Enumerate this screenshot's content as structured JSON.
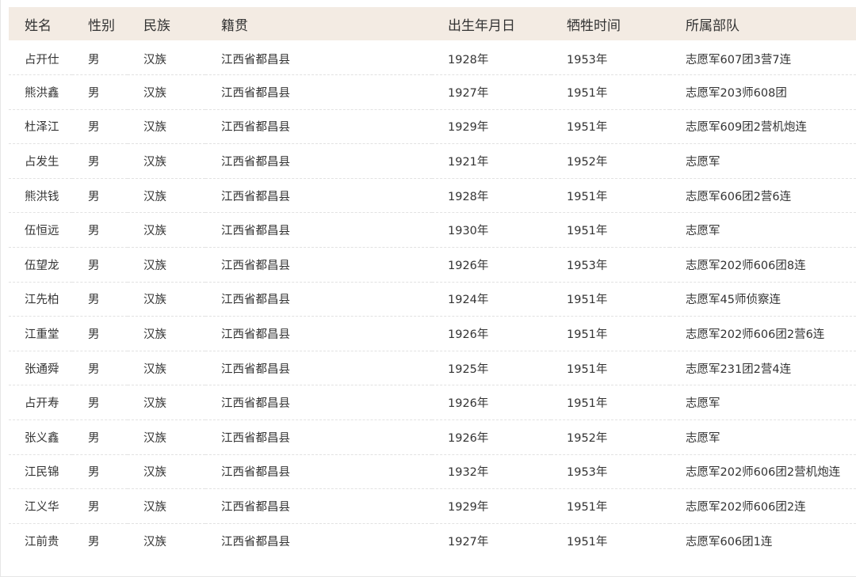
{
  "table": {
    "headers": [
      "姓名",
      "性别",
      "民族",
      "籍贯",
      "出生年月日",
      "牺牲时间",
      "所属部队"
    ],
    "rows": [
      [
        "占开仕",
        "男",
        "汉族",
        "江西省都昌县",
        "1928年",
        "1953年",
        "志愿军607团3营7连"
      ],
      [
        "熊洪鑫",
        "男",
        "汉族",
        "江西省都昌县",
        "1927年",
        "1951年",
        "志愿军203师608团"
      ],
      [
        "杜泽江",
        "男",
        "汉族",
        "江西省都昌县",
        "1929年",
        "1951年",
        "志愿军609团2营机炮连"
      ],
      [
        "占发生",
        "男",
        "汉族",
        "江西省都昌县",
        "1921年",
        "1952年",
        "志愿军"
      ],
      [
        "熊洪钱",
        "男",
        "汉族",
        "江西省都昌县",
        "1928年",
        "1951年",
        "志愿军606团2营6连"
      ],
      [
        "伍恒远",
        "男",
        "汉族",
        "江西省都昌县",
        "1930年",
        "1951年",
        "志愿军"
      ],
      [
        "伍望龙",
        "男",
        "汉族",
        "江西省都昌县",
        "1926年",
        "1953年",
        "志愿军202师606团8连"
      ],
      [
        "江先柏",
        "男",
        "汉族",
        "江西省都昌县",
        "1924年",
        "1951年",
        "志愿军45师侦察连"
      ],
      [
        "江重堂",
        "男",
        "汉族",
        "江西省都昌县",
        "1926年",
        "1951年",
        "志愿军202师606团2营6连"
      ],
      [
        "张通舜",
        "男",
        "汉族",
        "江西省都昌县",
        "1925年",
        "1951年",
        "志愿军231团2营4连"
      ],
      [
        "占开寿",
        "男",
        "汉族",
        "江西省都昌县",
        "1926年",
        "1951年",
        "志愿军"
      ],
      [
        "张义鑫",
        "男",
        "汉族",
        "江西省都昌县",
        "1926年",
        "1952年",
        "志愿军"
      ],
      [
        "江民锦",
        "男",
        "汉族",
        "江西省都昌县",
        "1932年",
        "1953年",
        "志愿军202师606团2营机炮连"
      ],
      [
        "江义华",
        "男",
        "汉族",
        "江西省都昌县",
        "1929年",
        "1951年",
        "志愿军202师606团2连"
      ],
      [
        "江前贵",
        "男",
        "汉族",
        "江西省都昌县",
        "1927年",
        "1951年",
        "志愿军606团1连"
      ]
    ]
  },
  "colors": {
    "header_bg": "#f3ebe3",
    "text": "#333333",
    "row_divider": "#e2e2e2"
  }
}
